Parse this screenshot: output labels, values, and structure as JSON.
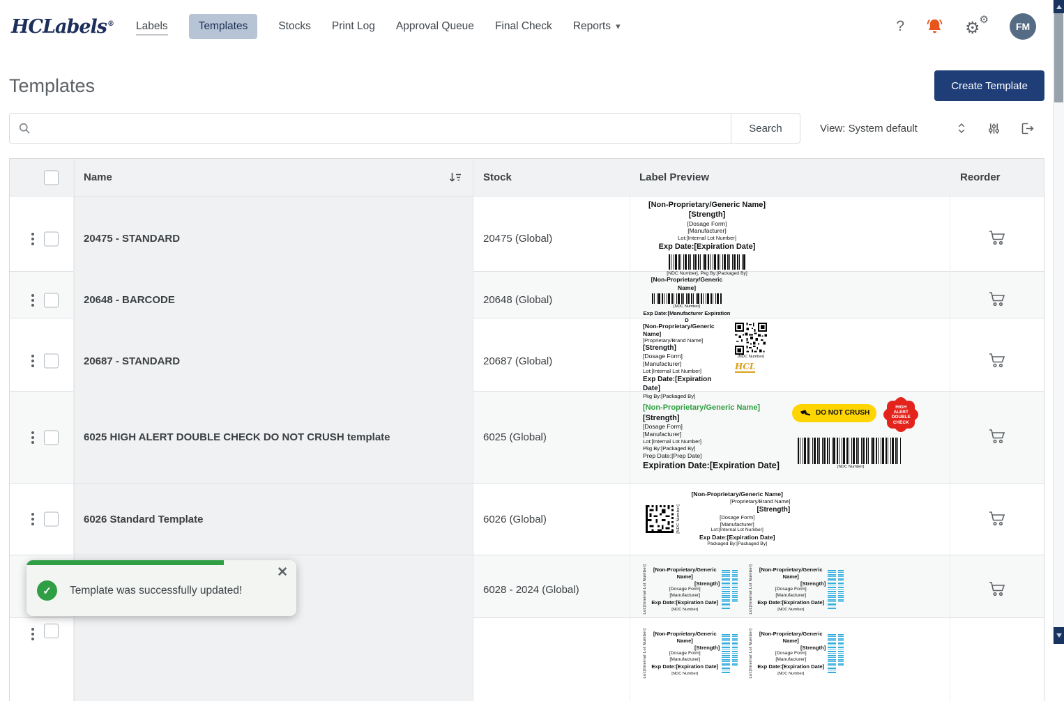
{
  "brand": {
    "logo_text": "HCLabels",
    "registered": "®"
  },
  "icons": {
    "help": "?",
    "gear": "⚙",
    "caret": "▾",
    "close": "✕",
    "check": "✓"
  },
  "colors": {
    "primary": "#1f3e78",
    "active_tab_bg": "#b6c4d6",
    "success": "#2f9e44",
    "bell": "#e8551c",
    "table_header_bg": "#f1f2f3"
  },
  "nav": {
    "items": [
      "Labels",
      "Templates",
      "Stocks",
      "Print Log",
      "Approval Queue",
      "Final Check",
      "Reports"
    ],
    "active": "Templates",
    "avatar_initials": "FM"
  },
  "page": {
    "title": "Templates",
    "create_button_label": "Create Template"
  },
  "toolbar": {
    "search_button_label": "Search",
    "view_label": "View: System default"
  },
  "table": {
    "headers": {
      "name": "Name",
      "stock": "Stock",
      "preview": "Label Preview",
      "reorder": "Reorder"
    },
    "rows": [
      {
        "name": "20475 - STANDARD",
        "stock": "20475 (Global)"
      },
      {
        "name": "20648 - BARCODE",
        "stock": "20648 (Global)"
      },
      {
        "name": "20687 - STANDARD",
        "stock": "20687 (Global)"
      },
      {
        "name": "6025 HIGH ALERT DOUBLE CHECK DO NOT CRUSH template",
        "stock": "6025 (Global)"
      },
      {
        "name": "6026 Standard Template",
        "stock": "6026 (Global)"
      },
      {
        "name": "",
        "stock": "6028 - 2024 (Global)"
      },
      {
        "name": "",
        "stock": ""
      }
    ]
  },
  "previews": {
    "p1": {
      "generic": "[Non-Proprietary/Generic Name]",
      "strength": "[Strength]",
      "dosage": "[Dosage Form]",
      "manufacturer": "[Manufacturer]",
      "lot": "Lot:[Internal Lot Number]",
      "exp": "Exp Date:[Expiration Date]",
      "footer": "[NDC Number], Pkg By:[Packaged By]"
    },
    "p2": {
      "generic": "[Non-Proprietary/Generic Name]",
      "ndc": "[NDC Number]",
      "exp": "Exp Date:[Manufacturer Expiration D"
    },
    "p3": {
      "generic": "[Non-Proprietary/Generic Name]",
      "brand": "[Proprietary/Brand Name]",
      "strength": "[Strength]",
      "dosage": "[Dosage Form]",
      "manufacturer": "[Manufacturer]",
      "lot": "Lot:[Internal Lot Number]",
      "exp": "Exp Date:[Expiration Date]",
      "pkg": "Pkg By:[Packaged By]",
      "ndc": "[NDC Number]",
      "logo": "HCL"
    },
    "p4": {
      "generic": "[Non-Proprietary/Generic Name]",
      "strength": "[Strength]",
      "dosage": "[Dosage Form]",
      "manufacturer": "[Manufacturer]",
      "lot": "Lot:[Internal Lot Number]",
      "pkg": "Pkg By:[Packaged By]",
      "prep": "Prep Date:[Prep Date]",
      "exp": "Expiration Date:[Expiration Date]",
      "crush_label": "DO NOT CRUSH",
      "alert_lines": [
        "HIGH",
        "ALERT",
        "DOUBLE",
        "CHECK"
      ],
      "ndc": "[NDC Number]"
    },
    "p5": {
      "generic": "[Non-Proprietary/Generic Name]",
      "brand": "[Proprietary/Brand Name]",
      "strength": "[Strength]",
      "dosage": "[Dosage Form]",
      "manufacturer": "[Manufacturer]",
      "lot": "Lot:[Internal Lot Number]",
      "exp": "Exp Date:[Expiration Date]",
      "pkg": "Packaged By:[Packaged By]",
      "ndc": "[NDC Number]"
    },
    "p6": {
      "generic": "[Non-Proprietary/Generic Name]",
      "strength": "[Strength]",
      "dosage": "[Dosage Form]",
      "manufacturer": "[Manufacturer]",
      "exp": "Exp Date:[Expiration Date]",
      "lot": "Lot:[Internal Lot Number]",
      "ndc": "[NDC Number]"
    }
  },
  "toast": {
    "message": "Template was successfully updated!"
  }
}
